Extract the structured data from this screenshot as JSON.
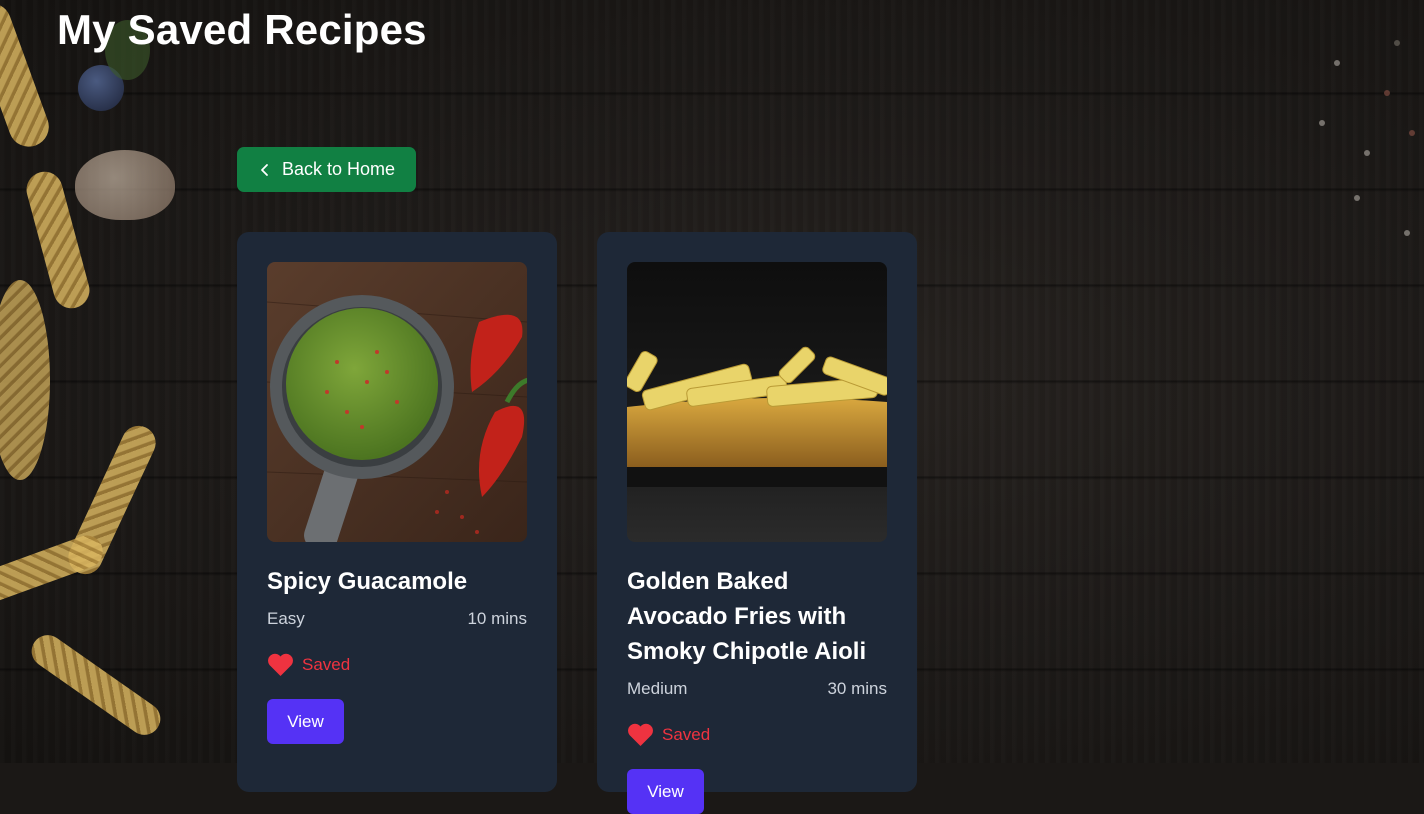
{
  "header": {
    "title": "My Saved Recipes"
  },
  "nav": {
    "back_label": "Back to Home"
  },
  "recipes": [
    {
      "title": "Spicy Guacamole",
      "difficulty": "Easy",
      "time": "10 mins",
      "saved_label": "Saved",
      "view_label": "View",
      "image": "guacamole-photo"
    },
    {
      "title": "Golden Baked Avocado Fries with Smoky Chipotle Aioli",
      "difficulty": "Medium",
      "time": "30 mins",
      "saved_label": "Saved",
      "view_label": "View",
      "image": "avocado-fries-photo"
    }
  ],
  "colors": {
    "back_button": "#118043",
    "card": "#1e2837",
    "saved": "#ef3340",
    "view_button": "#5532f5"
  }
}
